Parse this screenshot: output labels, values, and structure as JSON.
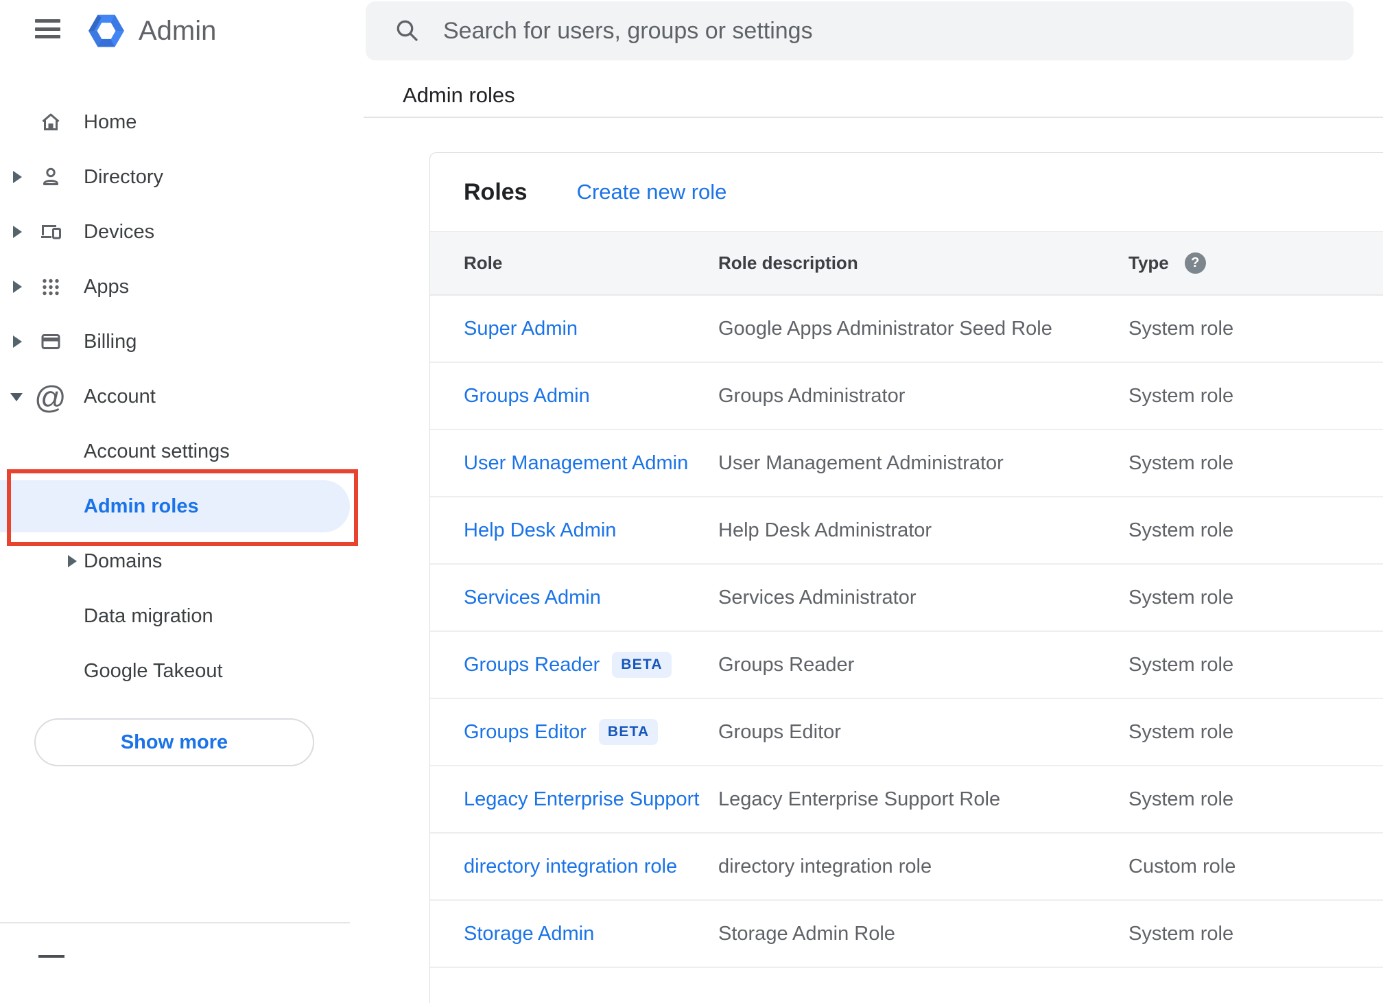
{
  "colors": {
    "accent_blue": "#1a73e8",
    "selected_bg": "#e8f0fe",
    "annotation_red": "#e8432e",
    "search_bg": "#f1f3f4",
    "icon_gray": "#5f6368",
    "text_dark": "#202124",
    "text_gray": "#5f6368",
    "table_header_bg": "#f5f6f7"
  },
  "header": {
    "brand": "Admin",
    "search_placeholder": "Search for users, groups or settings"
  },
  "sidebar": {
    "items": [
      {
        "label": "Home",
        "icon": "home-icon"
      },
      {
        "label": "Directory",
        "icon": "directory-icon",
        "expandable": true
      },
      {
        "label": "Devices",
        "icon": "devices-icon",
        "expandable": true
      },
      {
        "label": "Apps",
        "icon": "apps-icon",
        "expandable": true
      },
      {
        "label": "Billing",
        "icon": "billing-icon",
        "expandable": true
      },
      {
        "label": "Account",
        "icon": "account-icon",
        "expandable": true,
        "expanded": true
      },
      {
        "label": "Account settings",
        "indent": true
      },
      {
        "label": "Admin roles",
        "indent": true,
        "selected": true
      },
      {
        "label": "Domains",
        "indent": true,
        "expandable": true
      },
      {
        "label": "Data migration",
        "indent": true
      },
      {
        "label": "Google Takeout",
        "indent": true
      }
    ],
    "show_more_label": "Show more"
  },
  "breadcrumb": {
    "label": "Admin roles"
  },
  "annotation": {
    "target": "Admin roles",
    "color": "#e8432e"
  },
  "roles_card": {
    "title": "Roles",
    "create_link": "Create new role",
    "columns": {
      "role": "Role",
      "description": "Role description",
      "type": "Type"
    },
    "rows": [
      {
        "role": "Super Admin",
        "description": "Google Apps Administrator Seed Role",
        "type": "System role"
      },
      {
        "role": "Groups Admin",
        "description": "Groups Administrator",
        "type": "System role"
      },
      {
        "role": "User Management Admin",
        "description": "User Management Administrator",
        "type": "System role"
      },
      {
        "role": "Help Desk Admin",
        "description": "Help Desk Administrator",
        "type": "System role"
      },
      {
        "role": "Services Admin",
        "description": "Services Administrator",
        "type": "System role"
      },
      {
        "role": "Groups Reader",
        "badge": "BETA",
        "description": "Groups Reader",
        "type": "System role"
      },
      {
        "role": "Groups Editor",
        "badge": "BETA",
        "description": "Groups Editor",
        "type": "System role"
      },
      {
        "role": "Legacy Enterprise Support",
        "description": "Legacy Enterprise Support Role",
        "type": "System role"
      },
      {
        "role": "directory integration role",
        "description": "directory integration role",
        "type": "Custom role"
      },
      {
        "role": "Storage Admin",
        "description": "Storage Admin Role",
        "type": "System role"
      }
    ]
  }
}
